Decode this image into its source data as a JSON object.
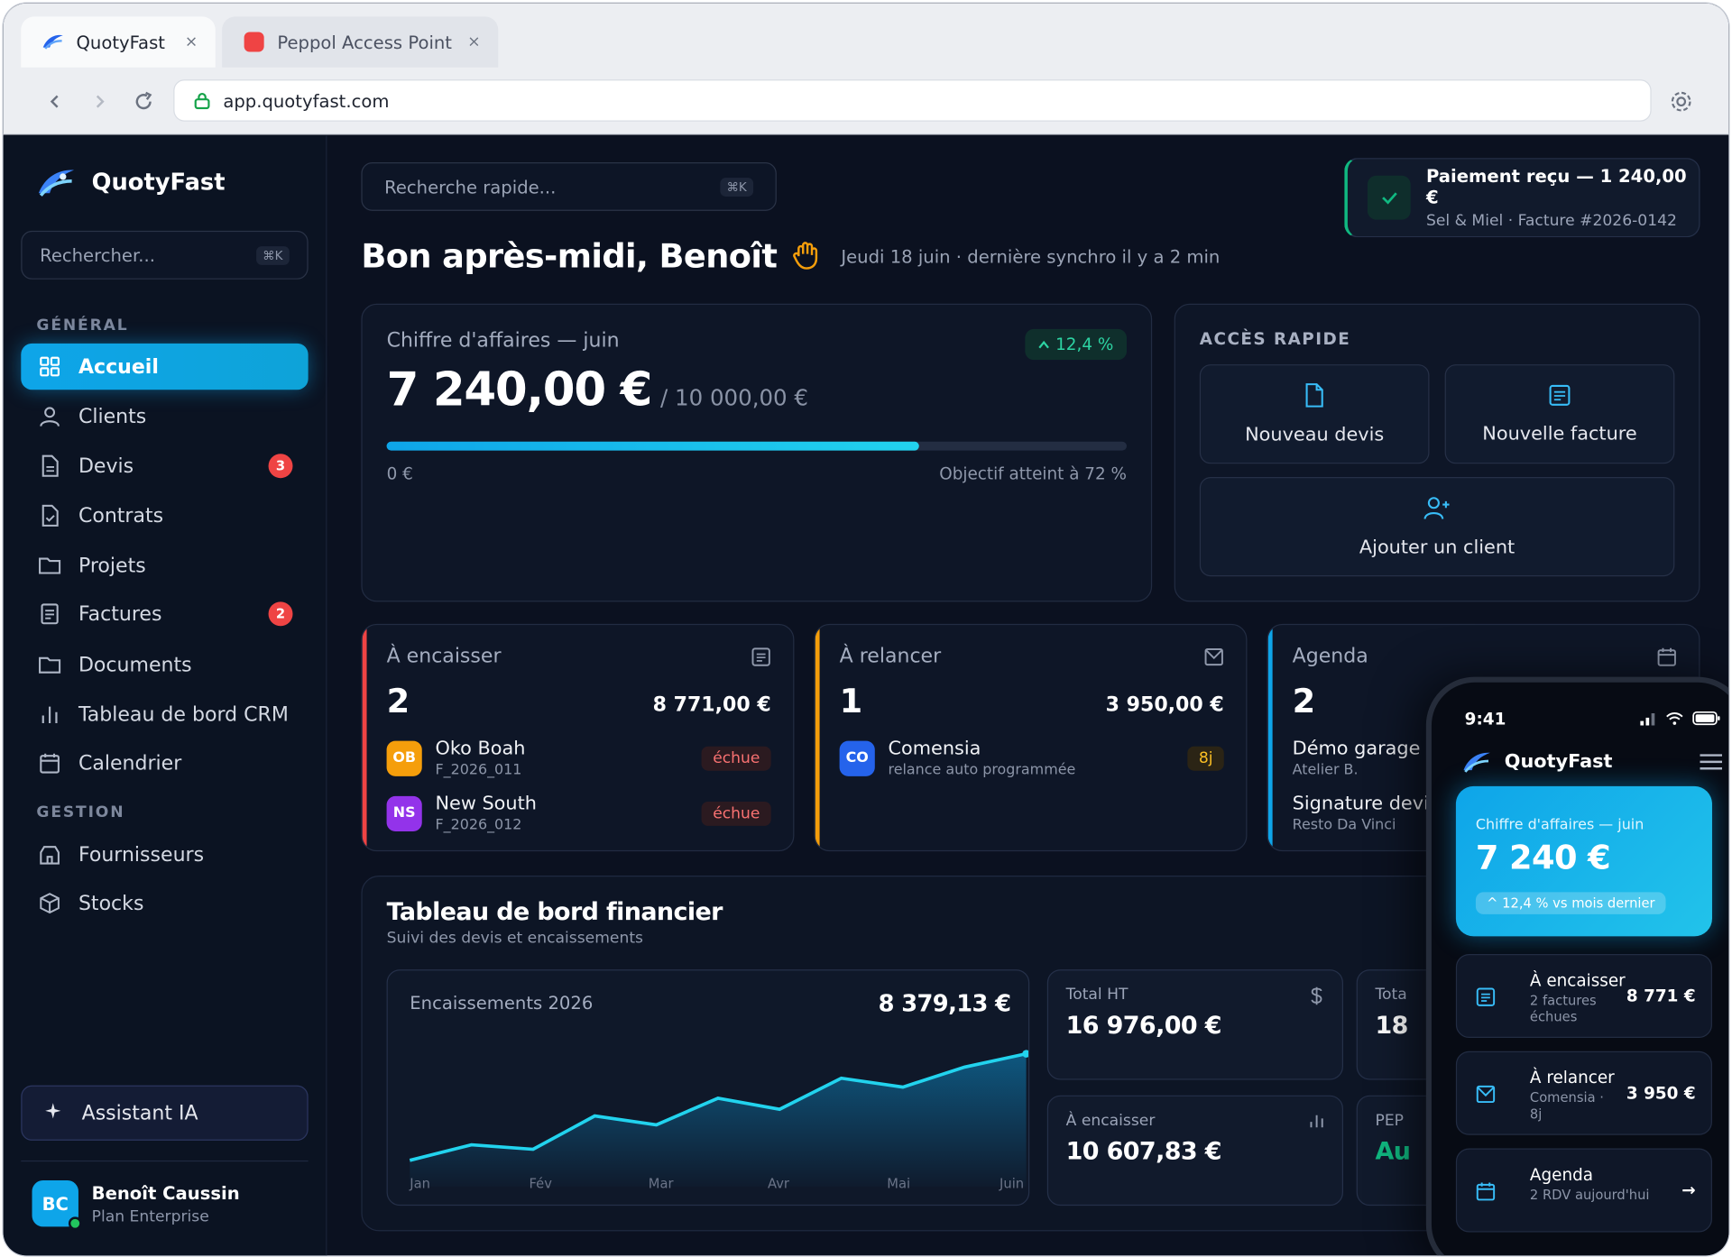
{
  "browser": {
    "tabs": [
      {
        "label": "QuotyFast",
        "close": "×"
      },
      {
        "label": "Peppol Access Point",
        "close": "×"
      }
    ],
    "url": "app.quotyfast.com"
  },
  "sidebar": {
    "brand": "QuotyFast",
    "search_placeholder": "Rechercher...",
    "search_kbd": "⌘K",
    "section_general": "GÉNÉRAL",
    "section_gestion": "GESTION",
    "items": [
      {
        "label": "Accueil",
        "icon": "grid-icon"
      },
      {
        "label": "Clients",
        "icon": "user-icon"
      },
      {
        "label": "Devis",
        "icon": "file-icon",
        "badge": "3"
      },
      {
        "label": "Contrats",
        "icon": "file-check-icon"
      },
      {
        "label": "Projets",
        "icon": "folder-icon"
      },
      {
        "label": "Factures",
        "icon": "receipt-icon",
        "badge": "2"
      },
      {
        "label": "Documents",
        "icon": "folder-icon"
      },
      {
        "label": "Tableau de bord CRM",
        "icon": "bar-chart-icon"
      },
      {
        "label": "Calendrier",
        "icon": "calendar-icon"
      },
      {
        "label": "Fournisseurs",
        "icon": "store-icon"
      },
      {
        "label": "Stocks",
        "icon": "box-icon"
      }
    ],
    "assistant": "Assistant IA",
    "user": {
      "initials": "BC",
      "name": "Benoît Caussin",
      "plan": "Plan Enterprise"
    }
  },
  "main": {
    "quick_search": "Recherche rapide...",
    "quick_search_kbd": "⌘K",
    "toast": {
      "title": "Paiement reçu — 1 240,00 €",
      "subtitle": "Sel & Miel · Facture #2026-0142"
    },
    "greeting": "Bon après-midi, Benoît",
    "greeting_sub": "Jeudi 18 juin · dernière synchro il y a 2 min",
    "revenue": {
      "title": "Chiffre d'affaires — juin",
      "trend": "12,4 %",
      "amount": "7 240,00 €",
      "target": "/ 10 000,00 €",
      "progress": 0.72,
      "start": "0 €",
      "reached": "Objectif atteint à 72 %"
    },
    "quick_access": {
      "title": "ACCÈS RAPIDE",
      "new_quote": "Nouveau devis",
      "new_invoice": "Nouvelle facture",
      "add_client": "Ajouter un client"
    },
    "to_collect": {
      "title": "À encaisser",
      "count": "2",
      "amount": "8 771,00 €",
      "rows": [
        {
          "initials": "OB",
          "name": "Oko Boah",
          "ref": "F_2026_011",
          "tag": "échue"
        },
        {
          "initials": "NS",
          "name": "New South",
          "ref": "F_2026_012",
          "tag": "échue"
        }
      ]
    },
    "to_remind": {
      "title": "À relancer",
      "count": "1",
      "amount": "3 950,00 €",
      "rows": [
        {
          "initials": "CO",
          "name": "Comensia",
          "ref": "relance auto programmée",
          "tag": "8j"
        }
      ]
    },
    "agenda": {
      "title": "Agenda",
      "count": "2",
      "rows": [
        {
          "name": "Démo garage —",
          "ref": "Atelier B."
        },
        {
          "name": "Signature devis",
          "ref": "Resto Da Vinci"
        }
      ]
    },
    "finance": {
      "title": "Tableau de bord financier",
      "subtitle": "Suivi des devis et encaissements",
      "chart_title": "Encaissements 2026",
      "chart_total": "8 379,13 €",
      "stats": [
        {
          "label": "Total HT",
          "value": "16 976,00 €",
          "icon": "dollar-icon"
        },
        {
          "label": "Tota",
          "value": "18"
        },
        {
          "label": "À encaisser",
          "value": "10 607,83 €",
          "icon": "bar-chart-icon"
        },
        {
          "label": "PEP",
          "value": "Au"
        }
      ]
    }
  },
  "chart_data": {
    "type": "area",
    "title": "Encaissements 2026",
    "x": [
      "Jan",
      "Fév",
      "Mar",
      "Avr",
      "Mai",
      "Juin"
    ],
    "series": [
      {
        "values": [
          800,
          1500,
          1300,
          2800,
          2400,
          3600,
          3100,
          4500,
          4100,
          5000,
          5600
        ]
      }
    ],
    "x_ticks": [
      "Jan",
      "Fév",
      "Mar",
      "Avr",
      "Mai",
      "Juin"
    ],
    "grid": false,
    "accent": "#22d3ee"
  },
  "phone": {
    "time": "9:41",
    "brand": "QuotyFast",
    "hero_title": "Chiffre d'affaires — juin",
    "hero_amount": "7 240 €",
    "hero_trend": "^ 12,4 % vs mois dernier",
    "items": [
      {
        "title": "À encaisser",
        "sub": "2 factures échues",
        "value": "8 771 €"
      },
      {
        "title": "À relancer",
        "sub": "Comensia · 8j",
        "value": "3 950 €"
      },
      {
        "title": "Agenda",
        "sub": "2 RDV aujourd'hui",
        "value": "→"
      }
    ]
  },
  "colors": {
    "accent": "#0ea5e9",
    "success": "#10b981",
    "danger": "#ef4444",
    "warning": "#f59e0b",
    "info": "#0ea5e9"
  }
}
